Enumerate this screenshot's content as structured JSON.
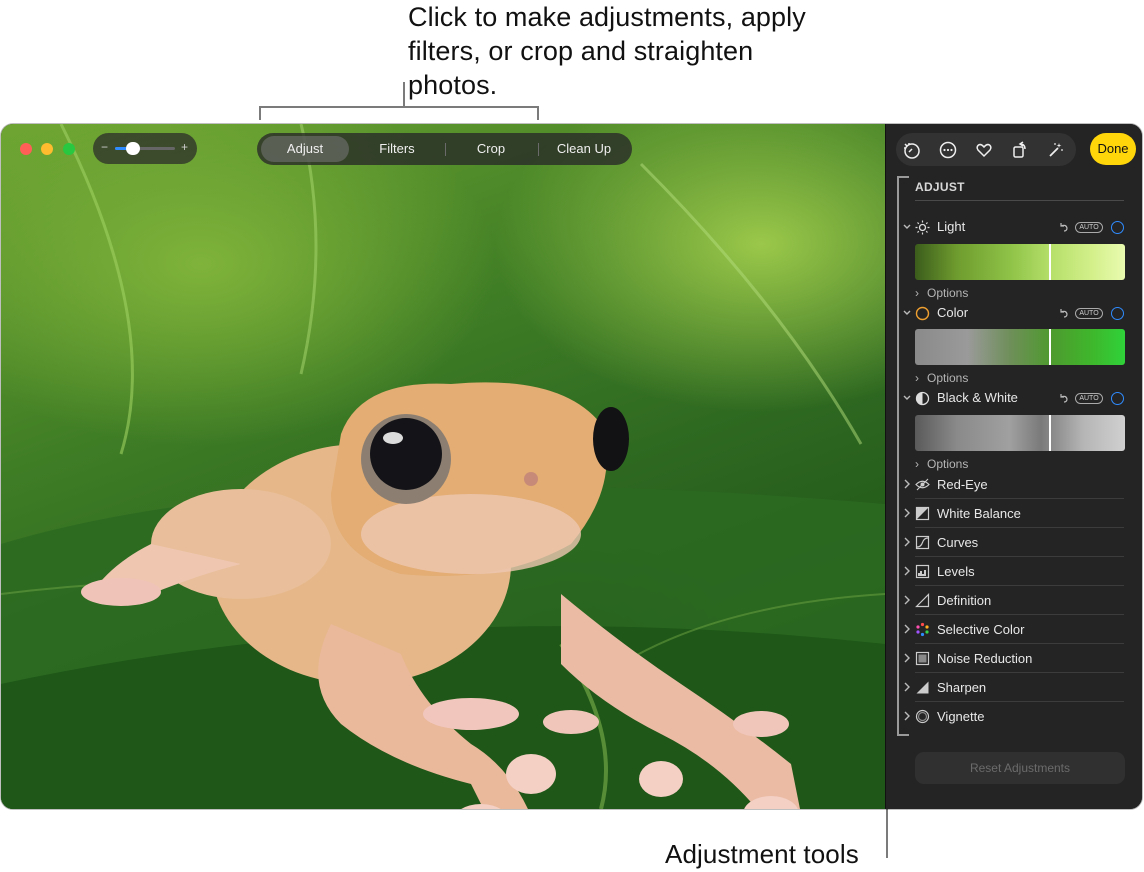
{
  "callouts": {
    "top": "Click to make adjustments, apply filters, or crop and straighten photos.",
    "bottom": "Adjustment tools"
  },
  "window": {
    "traffic_lights": [
      "#ff5f57",
      "#febc2e",
      "#28c840"
    ],
    "zoom": {
      "minus": "−",
      "plus": "+",
      "level": 0.3
    },
    "tabs": [
      {
        "label": "Adjust",
        "active": true
      },
      {
        "label": "Filters",
        "active": false
      },
      {
        "label": "Crop",
        "active": false
      },
      {
        "label": "Clean Up",
        "active": false
      }
    ],
    "photo": {
      "subject": "frog on leaf"
    }
  },
  "sidebar": {
    "toolbar_icons": [
      "magic-enhance-icon",
      "more-icon",
      "favorite-heart-icon",
      "rotate-icon",
      "auto-enhance-wand-icon"
    ],
    "done_label": "Done",
    "heading": "ADJUST",
    "sections": [
      {
        "label": "Light",
        "icon": "sun-icon",
        "auto": "AUTO",
        "options": "Options"
      },
      {
        "label": "Color",
        "icon": "color-circle-icon",
        "auto": "AUTO",
        "options": "Options"
      },
      {
        "label": "Black & White",
        "icon": "half-circle-icon",
        "auto": "AUTO",
        "options": "Options"
      }
    ],
    "tools": [
      {
        "label": "Red-Eye",
        "icon": "eye-icon"
      },
      {
        "label": "White Balance",
        "icon": "white-balance-icon"
      },
      {
        "label": "Curves",
        "icon": "curves-icon"
      },
      {
        "label": "Levels",
        "icon": "levels-icon"
      },
      {
        "label": "Definition",
        "icon": "definition-icon"
      },
      {
        "label": "Selective Color",
        "icon": "selective-color-icon"
      },
      {
        "label": "Noise Reduction",
        "icon": "noise-reduction-icon"
      },
      {
        "label": "Sharpen",
        "icon": "sharpen-icon"
      },
      {
        "label": "Vignette",
        "icon": "vignette-icon"
      }
    ],
    "reset_label": "Reset Adjustments",
    "accent": "#2f8cff",
    "done_color": "#ffd60a"
  }
}
